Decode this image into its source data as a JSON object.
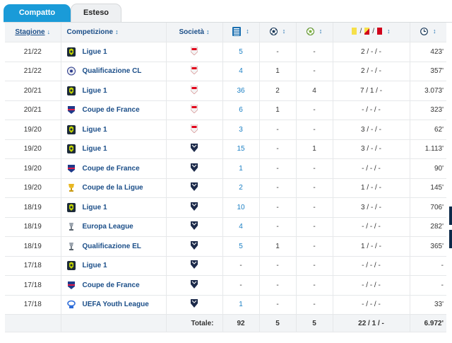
{
  "tabs": {
    "active": "Compatto",
    "inactive": "Esteso"
  },
  "columns": {
    "season": "Stagione",
    "competition": "Competizione",
    "club": "Società",
    "sort_arrow": "↓",
    "sort_both": "↕",
    "cards_sep": "/"
  },
  "rows": [
    {
      "season": "21/22",
      "comp": "Ligue 1",
      "comp_logo": "ligue1-logo",
      "club_logo": "monaco-crest",
      "apps": "5",
      "goals": "-",
      "assists": "-",
      "cards": "2 / - / -",
      "minutes": "423'"
    },
    {
      "season": "21/22",
      "comp": "Qualificazione CL",
      "comp_logo": "champions-league-logo",
      "club_logo": "monaco-crest",
      "apps": "4",
      "goals": "1",
      "assists": "-",
      "cards": "2 / - / -",
      "minutes": "357'"
    },
    {
      "season": "20/21",
      "comp": "Ligue 1",
      "comp_logo": "ligue1-logo",
      "club_logo": "monaco-crest",
      "apps": "36",
      "goals": "2",
      "assists": "4",
      "cards": "7 / 1 / -",
      "minutes": "3.073'"
    },
    {
      "season": "20/21",
      "comp": "Coupe de France",
      "comp_logo": "coupe-de-france-logo",
      "club_logo": "monaco-crest",
      "apps": "6",
      "goals": "1",
      "assists": "-",
      "cards": "- / - / -",
      "minutes": "323'"
    },
    {
      "season": "19/20",
      "comp": "Ligue 1",
      "comp_logo": "ligue1-logo",
      "club_logo": "monaco-crest",
      "apps": "3",
      "goals": "-",
      "assists": "-",
      "cards": "3 / - / -",
      "minutes": "62'"
    },
    {
      "season": "19/20",
      "comp": "Ligue 1",
      "comp_logo": "ligue1-logo",
      "club_logo": "bordeaux-crest",
      "apps": "15",
      "goals": "-",
      "assists": "1",
      "cards": "3 / - / -",
      "minutes": "1.113'"
    },
    {
      "season": "19/20",
      "comp": "Coupe de France",
      "comp_logo": "coupe-de-france-logo",
      "club_logo": "bordeaux-crest",
      "apps": "1",
      "goals": "-",
      "assists": "-",
      "cards": "- / - / -",
      "minutes": "90'"
    },
    {
      "season": "19/20",
      "comp": "Coupe de la Ligue",
      "comp_logo": "coupe-de-la-ligue-logo",
      "club_logo": "bordeaux-crest",
      "apps": "2",
      "goals": "-",
      "assists": "-",
      "cards": "1 / - / -",
      "minutes": "145'"
    },
    {
      "season": "18/19",
      "comp": "Ligue 1",
      "comp_logo": "ligue1-logo",
      "club_logo": "bordeaux-crest",
      "apps": "10",
      "goals": "-",
      "assists": "-",
      "cards": "3 / - / -",
      "minutes": "706'"
    },
    {
      "season": "18/19",
      "comp": "Europa League",
      "comp_logo": "europa-league-logo",
      "club_logo": "bordeaux-crest",
      "apps": "4",
      "goals": "-",
      "assists": "-",
      "cards": "- / - / -",
      "minutes": "282'"
    },
    {
      "season": "18/19",
      "comp": "Qualificazione EL",
      "comp_logo": "europa-league-logo",
      "club_logo": "bordeaux-crest",
      "apps": "5",
      "goals": "1",
      "assists": "-",
      "cards": "1 / - / -",
      "minutes": "365'"
    },
    {
      "season": "17/18",
      "comp": "Ligue 1",
      "comp_logo": "ligue1-logo",
      "club_logo": "bordeaux-crest",
      "apps": "-",
      "goals": "-",
      "assists": "-",
      "cards": "- / - / -",
      "minutes": "-"
    },
    {
      "season": "17/18",
      "comp": "Coupe de France",
      "comp_logo": "coupe-de-france-logo",
      "club_logo": "bordeaux-crest",
      "apps": "-",
      "goals": "-",
      "assists": "-",
      "cards": "- / - / -",
      "minutes": "-"
    },
    {
      "season": "17/18",
      "comp": "UEFA Youth League",
      "comp_logo": "uefa-youth-league-logo",
      "club_logo": "bordeaux-crest",
      "apps": "1",
      "goals": "-",
      "assists": "-",
      "cards": "- / - / -",
      "minutes": "33'"
    }
  ],
  "totals": {
    "label": "Totale:",
    "apps": "92",
    "goals": "5",
    "assists": "5",
    "cards": "22 / 1 / -",
    "minutes": "6.972'"
  },
  "colors": {
    "accent": "#1a9bd8",
    "link": "#1b4e88",
    "yellow_card": "#f6e04a",
    "red_card": "#d0021b"
  }
}
